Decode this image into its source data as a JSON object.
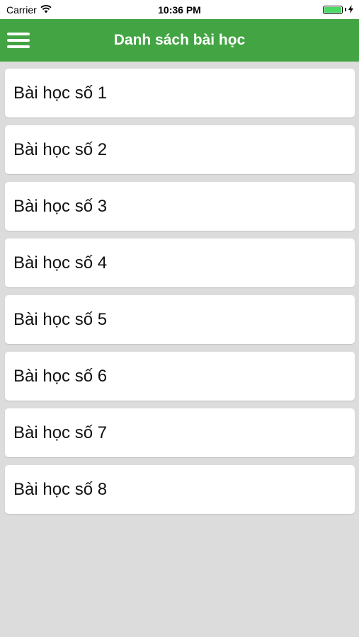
{
  "status_bar": {
    "carrier": "Carrier",
    "time": "10:36 PM",
    "battery_level": 1.0,
    "icons": [
      "wifi-icon",
      "battery-icon",
      "charging-bolt-icon"
    ]
  },
  "nav": {
    "title": "Danh sách bài học",
    "menu_icon": "hamburger-menu-icon",
    "background_color": "#43a443"
  },
  "lessons": [
    {
      "label": "Bài học số 1"
    },
    {
      "label": "Bài học số 2"
    },
    {
      "label": "Bài học số 3"
    },
    {
      "label": "Bài học số 4"
    },
    {
      "label": "Bài học số 5"
    },
    {
      "label": "Bài học số 6"
    },
    {
      "label": "Bài học số 7"
    },
    {
      "label": "Bài học số 8"
    }
  ]
}
